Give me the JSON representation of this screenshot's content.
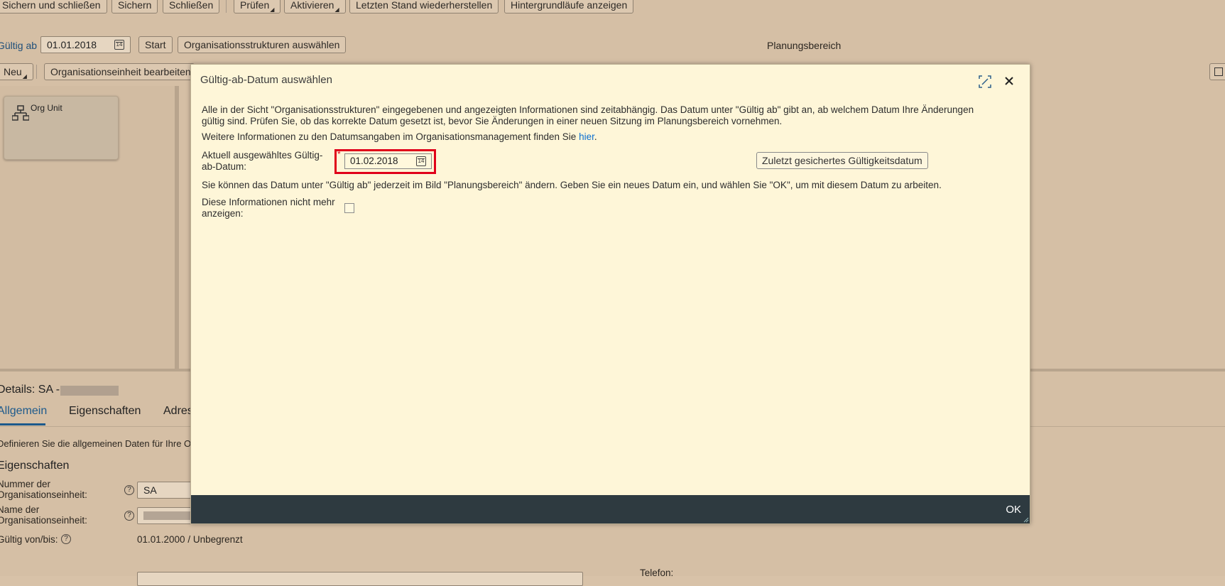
{
  "toolbar": {
    "save_close": "Sichern und schließen",
    "save": "Sichern",
    "close": "Schließen",
    "check": "Prüfen",
    "activate": "Aktivieren",
    "restore": "Letzten Stand wiederherstellen",
    "background_jobs": "Hintergrundläufe anzeigen"
  },
  "validity_bar": {
    "label": "Gültig ab",
    "date": "01.01.2018",
    "start_button": "Start",
    "select_org_button": "Organisationsstrukturen auswählen",
    "area_title": "Planungsbereich"
  },
  "second_toolbar": {
    "new_button": "Neu",
    "edit_org_button": "Organisationseinheit bearbeiten"
  },
  "org_tile": {
    "label": "Org Unit"
  },
  "details": {
    "title": "Details: SA -",
    "tabs": [
      "Allgemein",
      "Eigenschaften",
      "Adres"
    ],
    "description": "Definieren Sie die allgemeinen Daten für Ihre O",
    "section_title": "Eigenschaften",
    "number_label_1": "Nummer der",
    "number_label_2": "Organisationseinheit:",
    "number_value": "SA",
    "name_label_1": "Name der",
    "name_label_2": "Organisationseinheit:",
    "valid_label": "Gültig von/bis:",
    "valid_value": "01.01.2000 / Unbegrenzt",
    "phone_label": "Telefon:"
  },
  "dialog": {
    "title": "Gültig-ab-Datum auswählen",
    "paragraph_1_line_1": "Alle in der Sicht \"Organisationsstrukturen\" eingegebenen und angezeigten Informationen sind zeitabhängig. Das Datum unter \"Gültig ab\" gibt an, ab welchem Datum Ihre Änderungen",
    "paragraph_1_line_2": "gültig sind. Prüfen Sie, ob das korrekte Datum gesetzt ist, bevor Sie Änderungen in einer neuen Sitzung im Planungsbereich vornehmen.",
    "more_info": "Weitere Informationen zu den Datumsangaben im Organisationsmanagement finden Sie",
    "more_info_link": "hier",
    "more_info_end": ".",
    "date_label_1": "Aktuell ausgewähltes Gültig-",
    "date_label_2": "ab-Datum:",
    "required_marker": "*",
    "date_value": "01.02.2018",
    "last_saved_button": "Zuletzt gesichertes Gültigkeitsdatum",
    "change_info": "Sie können das Datum unter \"Gültig ab\" jederzeit im Bild \"Planungsbereich\" ändern. Geben Sie ein neues Datum ein, und wählen Sie \"OK\", um mit diesem Datum zu arbeiten.",
    "dont_show_label_1": "Diese Informationen nicht mehr",
    "dont_show_label_2": "anzeigen:",
    "dont_show_checked": false,
    "ok_button": "OK"
  },
  "icons": {
    "expand": "expand-icon",
    "close": "close-icon",
    "calendar": "calendar-icon",
    "org_structure": "org-structure-icon",
    "help": "help-icon",
    "table_settings": "table-settings-icon"
  },
  "colors": {
    "overlay_bg": "#d5bfa5",
    "dialog_bg": "#fef6d8",
    "footer_bg": "#2e3a40",
    "highlight": "#e0001a",
    "link": "#0a6ed1"
  }
}
